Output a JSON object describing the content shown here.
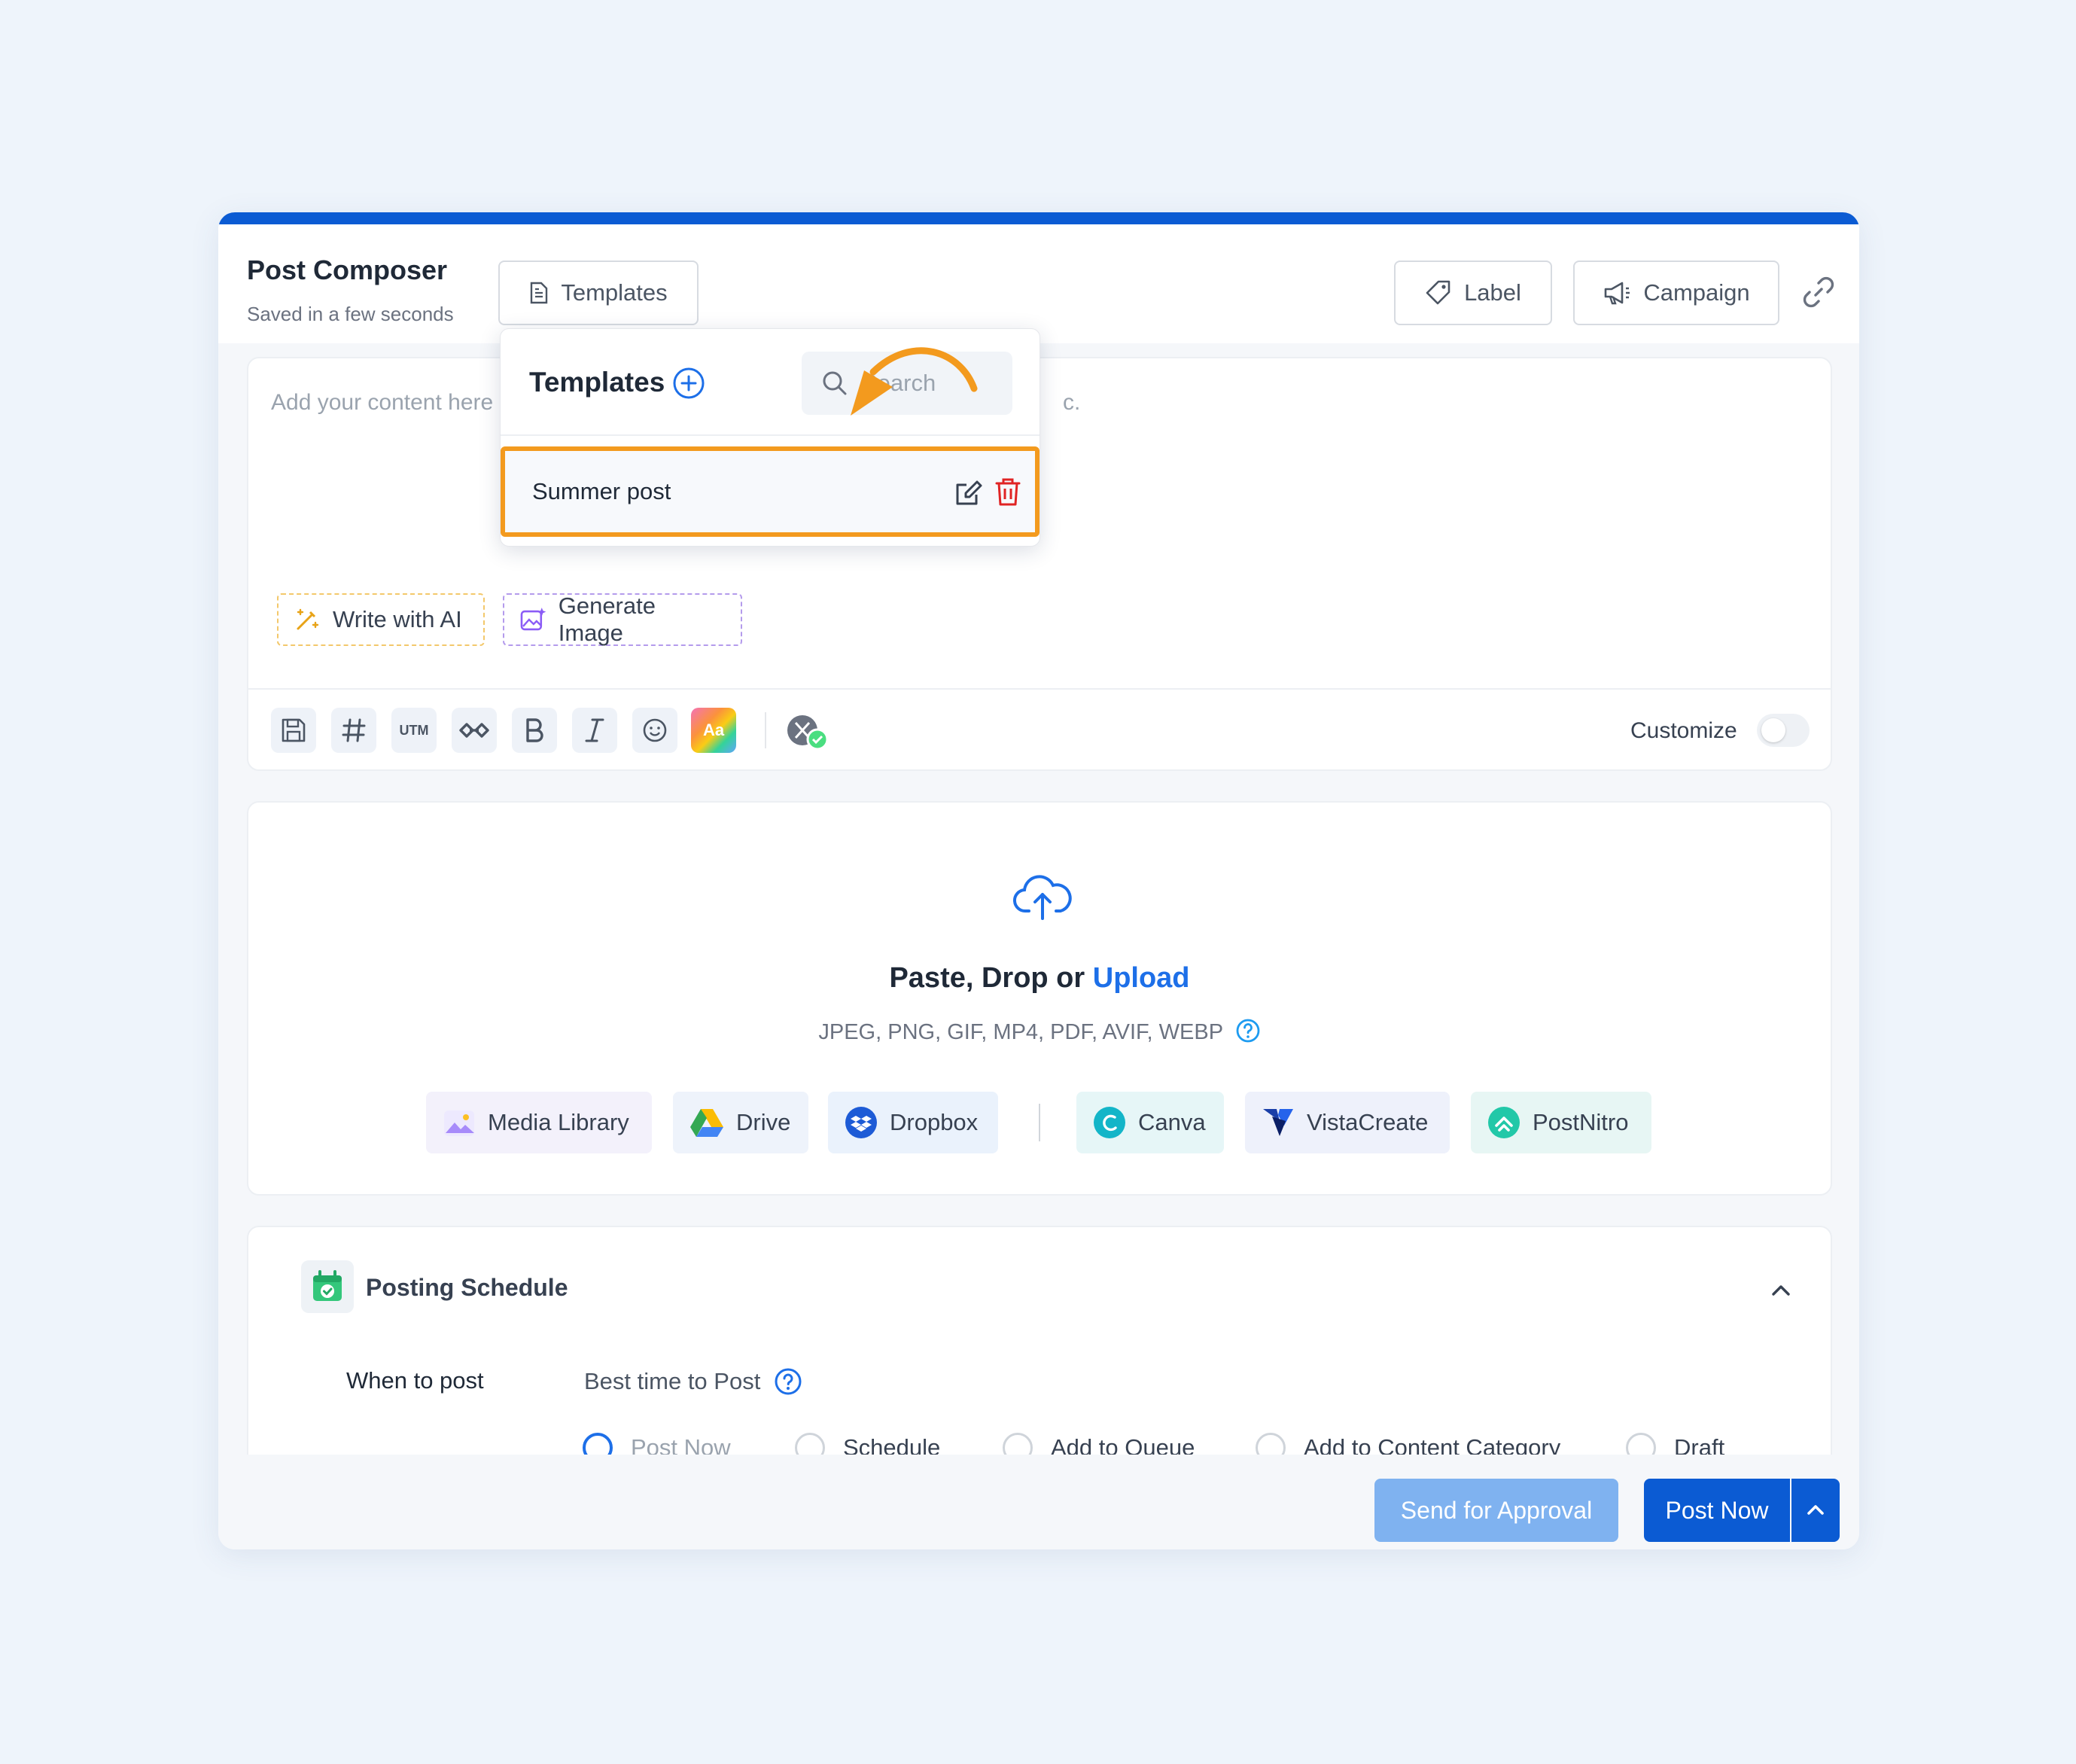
{
  "header": {
    "title": "Post Composer",
    "saved_status": "Saved in a few seconds",
    "templates_label": "Templates",
    "label_label": "Label",
    "campaign_label": "Campaign"
  },
  "editor": {
    "placeholder_left": "Add your content here",
    "placeholder_right_fragment": "c.",
    "write_ai_label": "Write with AI",
    "generate_image_label": "Generate Image",
    "toolbar": {
      "utm_label": "UTM",
      "ai_font_label": "Aa"
    },
    "customize_label": "Customize"
  },
  "templates_dropdown": {
    "title": "Templates",
    "search_placeholder": "Search",
    "items": [
      {
        "label": "Summer post"
      }
    ]
  },
  "media": {
    "title_prefix": "Paste, Drop or",
    "title_link": "Upload",
    "formats": "JPEG, PNG, GIF, MP4, PDF, AVIF, WEBP",
    "sources": [
      {
        "label": "Media Library"
      },
      {
        "label": "Drive"
      },
      {
        "label": "Dropbox"
      },
      {
        "label": "Canva"
      },
      {
        "label": "VistaCreate"
      },
      {
        "label": "PostNitro"
      }
    ]
  },
  "schedule": {
    "title": "Posting Schedule",
    "when_label": "When to post",
    "best_time_label": "Best time to Post",
    "options": [
      {
        "label": "Post Now",
        "selected": true
      },
      {
        "label": "Schedule",
        "selected": false
      },
      {
        "label": "Add to Queue",
        "selected": false
      },
      {
        "label": "Add to Content Category",
        "selected": false
      },
      {
        "label": "Draft",
        "selected": false
      }
    ]
  },
  "footer": {
    "send_approval_label": "Send for Approval",
    "post_now_label": "Post Now"
  },
  "colors": {
    "primary": "#0b5bd3",
    "primary_light": "#7fb2f0",
    "highlight": "#f39a1e",
    "link": "#1d6fe8",
    "delete": "#e02424"
  }
}
